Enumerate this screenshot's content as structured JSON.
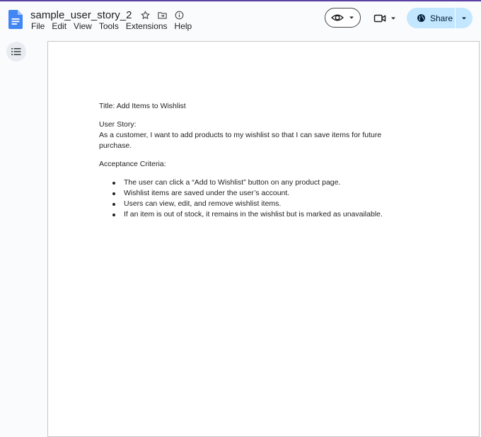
{
  "header": {
    "doc_title": "sample_user_story_2",
    "menu": [
      "File",
      "Edit",
      "View",
      "Tools",
      "Extensions",
      "Help"
    ],
    "share_label": "Share"
  },
  "icons": {
    "app": "google-docs-icon",
    "star": "star-icon",
    "move": "folder-move-icon",
    "status": "info-icon",
    "view": "eye-icon",
    "meet": "video-camera-icon",
    "share": "globe-icon",
    "outline": "list-icon"
  },
  "colors": {
    "accent_top": "#5b3fa3",
    "share_bg": "#c2e7ff",
    "docs_blue": "#4285f4"
  },
  "document": {
    "title_line": "Title: Add Items to Wishlist",
    "user_story_heading": "User Story:",
    "user_story_text": "As a customer, I want to add products to my wishlist so that I can save items for future purchase.",
    "acceptance_heading": "Acceptance Criteria:",
    "criteria": [
      "The user can click a “Add to Wishlist” button on any product page.",
      "Wishlist items are saved under the user’s account.",
      "Users can view, edit, and remove wishlist items.",
      "If an item is out of stock, it remains in the wishlist but is marked as unavailable."
    ]
  }
}
